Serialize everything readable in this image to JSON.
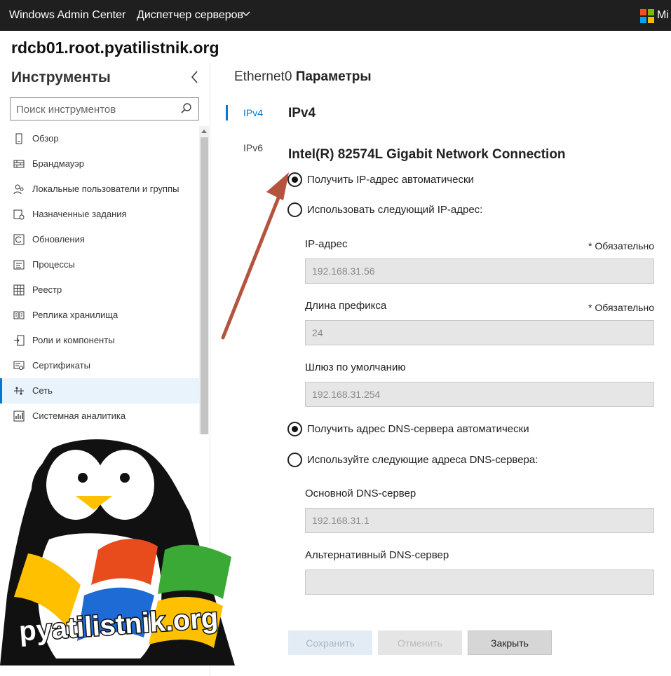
{
  "topbar": {
    "app_title": "Windows Admin Center",
    "server_manager": "Диспетчер серверов",
    "ms_text": "Mi",
    "ms_colors": [
      "#f25022",
      "#7fba00",
      "#00a4ef",
      "#ffb900"
    ]
  },
  "hostname": "rdcb01.root.pyatilistnik.org",
  "sidebar": {
    "title": "Инструменты",
    "search_placeholder": "Поиск инструментов",
    "items": [
      {
        "label": "Обзор",
        "icon": "overview-icon"
      },
      {
        "label": "Брандмауэр",
        "icon": "firewall-icon"
      },
      {
        "label": "Локальные пользователи и группы",
        "icon": "users-icon"
      },
      {
        "label": "Назначенные задания",
        "icon": "scheduled-tasks-icon"
      },
      {
        "label": "Обновления",
        "icon": "updates-icon"
      },
      {
        "label": "Процессы",
        "icon": "processes-icon"
      },
      {
        "label": "Реестр",
        "icon": "registry-icon"
      },
      {
        "label": "Реплика хранилища",
        "icon": "storage-replica-icon"
      },
      {
        "label": "Роли и компоненты",
        "icon": "roles-icon"
      },
      {
        "label": "Сертификаты",
        "icon": "certificates-icon"
      },
      {
        "label": "Сеть",
        "icon": "network-icon",
        "active": true
      },
      {
        "label": "Системная аналитика",
        "icon": "insights-icon"
      }
    ]
  },
  "logo": {
    "text": "pyatilistnik.org"
  },
  "main": {
    "adapter": "Ethernet0",
    "title": "Параметры",
    "tabs": [
      {
        "label": "IPv4",
        "active": true
      },
      {
        "label": "IPv6",
        "active": false
      }
    ],
    "section_title": "IPv4",
    "adapter_name": "Intel(R) 82574L Gigabit Network Connection",
    "ip_auto": "Получить IP-адрес автоматически",
    "ip_manual": "Использовать следующий IP-адрес:",
    "required": "* Обязательно",
    "ip_label": "IP-адрес",
    "ip_value": "192.168.31.56",
    "prefix_label": "Длина префикса",
    "prefix_value": "24",
    "gateway_label": "Шлюз по умолчанию",
    "gateway_value": "192.168.31.254",
    "dns_auto": "Получить адрес DNS-сервера автоматически",
    "dns_manual": "Используйте следующие адреса DNS-сервера:",
    "dns1_label": "Основной DNS-сервер",
    "dns1_value": "192.168.31.1",
    "dns2_label": "Альтернативный DNS-сервер",
    "dns2_value": "",
    "buttons": {
      "save": "Сохранить",
      "cancel": "Отменить",
      "close": "Закрыть"
    },
    "accent_color": "#0078d4",
    "arrow_color": "#b5533c"
  }
}
